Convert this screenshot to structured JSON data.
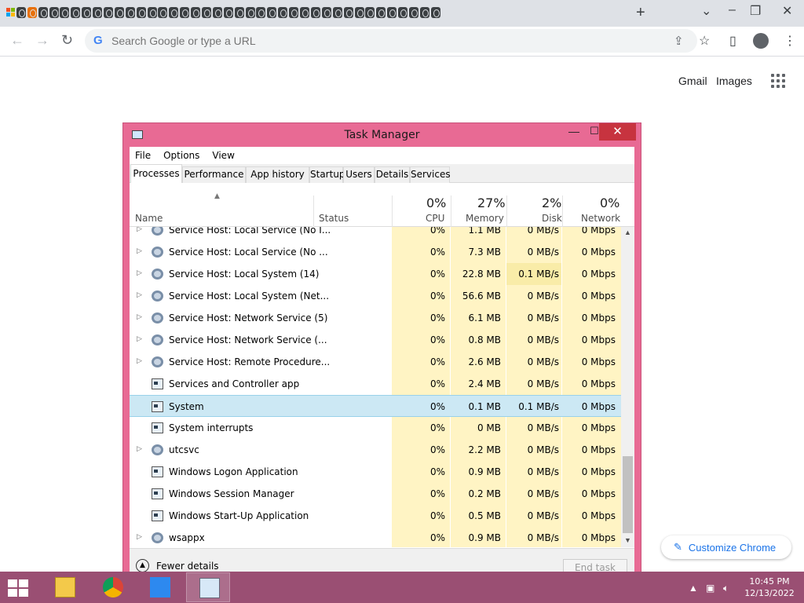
{
  "browser": {
    "omnibox_placeholder": "Search Google or type a URL",
    "new_tab_label": "+",
    "ntp_links": {
      "gmail": "Gmail",
      "images": "Images"
    },
    "customize_label": "Customize Chrome"
  },
  "task_manager": {
    "title": "Task Manager",
    "menu": [
      "File",
      "Options",
      "View"
    ],
    "tabs": [
      "Processes",
      "Performance",
      "App history",
      "Startup",
      "Users",
      "Details",
      "Services"
    ],
    "columns": {
      "name": "Name",
      "status": "Status",
      "cpu": {
        "label": "CPU",
        "pct": "0%"
      },
      "memory": {
        "label": "Memory",
        "pct": "27%"
      },
      "disk": {
        "label": "Disk",
        "pct": "2%"
      },
      "network": {
        "label": "Network",
        "pct": "0%"
      }
    },
    "rows": [
      {
        "name": "Service Host: Local Service (No I...",
        "cpu": "0%",
        "memory": "1.1 MB",
        "disk": "0 MB/s",
        "network": "0 Mbps",
        "icon": "gear-icon",
        "expandable": true
      },
      {
        "name": "Service Host: Local Service (No ...",
        "cpu": "0%",
        "memory": "7.3 MB",
        "disk": "0 MB/s",
        "network": "0 Mbps",
        "icon": "gear-icon",
        "expandable": true
      },
      {
        "name": "Service Host: Local System (14)",
        "cpu": "0%",
        "memory": "22.8 MB",
        "disk": "0.1 MB/s",
        "network": "0 Mbps",
        "icon": "gear-icon",
        "expandable": true
      },
      {
        "name": "Service Host: Local System (Net...",
        "cpu": "0%",
        "memory": "56.6 MB",
        "disk": "0 MB/s",
        "network": "0 Mbps",
        "icon": "gear-icon",
        "expandable": true
      },
      {
        "name": "Service Host: Network Service (5)",
        "cpu": "0%",
        "memory": "6.1 MB",
        "disk": "0 MB/s",
        "network": "0 Mbps",
        "icon": "gear-icon",
        "expandable": true
      },
      {
        "name": "Service Host: Network Service (...",
        "cpu": "0%",
        "memory": "0.8 MB",
        "disk": "0 MB/s",
        "network": "0 Mbps",
        "icon": "gear-icon",
        "expandable": true
      },
      {
        "name": "Service Host: Remote Procedure...",
        "cpu": "0%",
        "memory": "2.6 MB",
        "disk": "0 MB/s",
        "network": "0 Mbps",
        "icon": "gear-icon",
        "expandable": true
      },
      {
        "name": "Services and Controller app",
        "cpu": "0%",
        "memory": "2.4 MB",
        "disk": "0 MB/s",
        "network": "0 Mbps",
        "icon": "window-icon",
        "expandable": false
      },
      {
        "name": "System",
        "cpu": "0%",
        "memory": "0.1 MB",
        "disk": "0.1 MB/s",
        "network": "0 Mbps",
        "icon": "window-icon",
        "expandable": false,
        "selected": true
      },
      {
        "name": "System interrupts",
        "cpu": "0%",
        "memory": "0 MB",
        "disk": "0 MB/s",
        "network": "0 Mbps",
        "icon": "window-icon",
        "expandable": false
      },
      {
        "name": "utcsvc",
        "cpu": "0%",
        "memory": "2.2 MB",
        "disk": "0 MB/s",
        "network": "0 Mbps",
        "icon": "gear-icon",
        "expandable": true
      },
      {
        "name": "Windows Logon Application",
        "cpu": "0%",
        "memory": "0.9 MB",
        "disk": "0 MB/s",
        "network": "0 Mbps",
        "icon": "window-icon",
        "expandable": false
      },
      {
        "name": "Windows Session Manager",
        "cpu": "0%",
        "memory": "0.2 MB",
        "disk": "0 MB/s",
        "network": "0 Mbps",
        "icon": "window-icon",
        "expandable": false
      },
      {
        "name": "Windows Start-Up Application",
        "cpu": "0%",
        "memory": "0.5 MB",
        "disk": "0 MB/s",
        "network": "0 Mbps",
        "icon": "window-icon",
        "expandable": false
      },
      {
        "name": "wsappx",
        "cpu": "0%",
        "memory": "0.9 MB",
        "disk": "0 MB/s",
        "network": "0 Mbps",
        "icon": "gear-icon",
        "expandable": true
      }
    ],
    "fewer_details": "Fewer details",
    "end_task": "End task"
  },
  "taskbar": {
    "time": "10:45 PM",
    "date": "12/13/2022"
  },
  "colors": {
    "window_frame": "#e86a94",
    "close_button": "#c7333f",
    "heat_light": "#fff4c4",
    "selected_row": "#cce8f4",
    "taskbar": "#9a4f73"
  }
}
